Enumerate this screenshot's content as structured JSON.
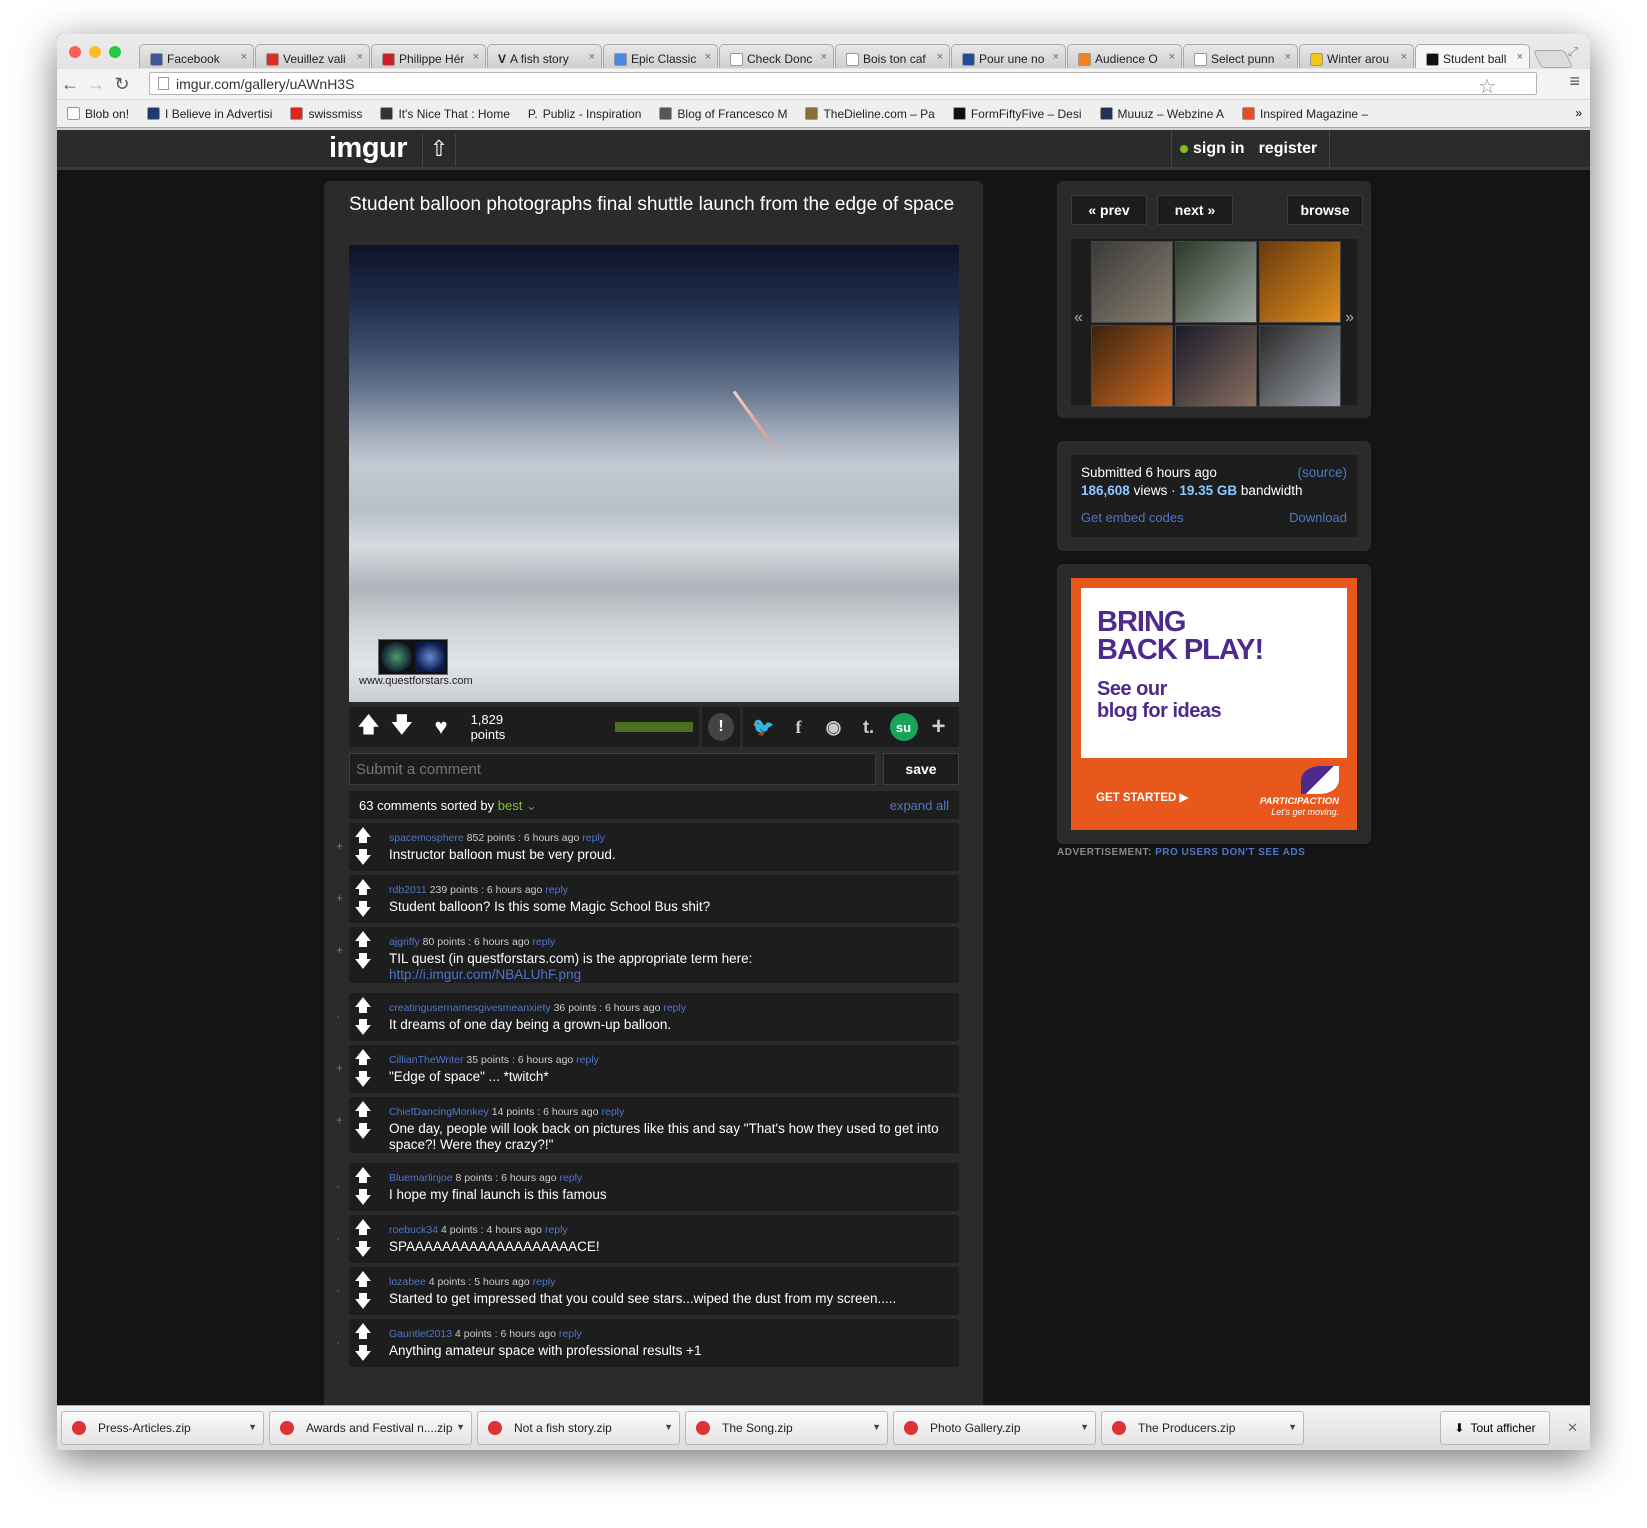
{
  "browser": {
    "tabs": [
      {
        "label": "Facebook",
        "color": "#3b5998"
      },
      {
        "label": "Veuillez vali",
        "color": "#d93025"
      },
      {
        "label": "Philippe Hér",
        "color": "#cb2027"
      },
      {
        "label": "A fish story",
        "color": "#222222",
        "prefix": "V"
      },
      {
        "label": "Epic Classic",
        "color": "#4a86e8"
      },
      {
        "label": "Check Donc",
        "color": "#ffffff"
      },
      {
        "label": "Bois ton caf",
        "color": "#ffffff"
      },
      {
        "label": "Pour une no",
        "color": "#1f4e9a"
      },
      {
        "label": "Audience O",
        "color": "#f58220"
      },
      {
        "label": "Select punn",
        "color": "#ffffff"
      },
      {
        "label": "Winter arou",
        "color": "#f5c518"
      },
      {
        "label": "Student ball",
        "color": "#111111"
      }
    ],
    "url": "imgur.com/gallery/uAWnH3S",
    "bookmarks": [
      {
        "label": "Blob on!",
        "color": "#ffffff"
      },
      {
        "label": "I Believe in Advertisi",
        "color": "#1e3a6e"
      },
      {
        "label": "swissmiss",
        "color": "#e2231a"
      },
      {
        "label": "It's Nice That : Home",
        "color": "#333333"
      },
      {
        "label": "Publiz - Inspiration",
        "color": "#ffffff",
        "prefix": "P."
      },
      {
        "label": "Blog of Francesco M",
        "color": "#555555"
      },
      {
        "label": "TheDieline.com – Pa",
        "color": "#8a6d3b"
      },
      {
        "label": "FormFiftyFive – Desi",
        "color": "#111111"
      },
      {
        "label": "Muuuz – Webzine A",
        "color": "#223355"
      },
      {
        "label": "Inspired Magazine –",
        "color": "#e44d26"
      }
    ]
  },
  "header": {
    "logo": "imgur",
    "sign_in": "sign in",
    "register": "register"
  },
  "post": {
    "title": "Student balloon photographs final shuttle launch from the edge of space",
    "watermark": "www.questforstars.com",
    "points": "1,829 points",
    "points_ratio": 1.0,
    "comment_placeholder": "Submit a comment",
    "save_label": "save",
    "sort_prefix": "63 comments sorted by",
    "sort_value": "best",
    "expand_all": "expand all"
  },
  "comments": [
    {
      "user": "spacemosphere",
      "meta": "852 points : 6 hours ago",
      "reply": "reply",
      "text": "Instructor balloon must be very proud.",
      "link": "",
      "marker": "+"
    },
    {
      "user": "rdb2011",
      "meta": "239 points : 6 hours ago",
      "reply": "reply",
      "text": "Student balloon? Is this some Magic School Bus shit?",
      "link": "",
      "marker": "+"
    },
    {
      "user": "ajgriffy",
      "meta": "80 points : 6 hours ago",
      "reply": "reply",
      "text": "TIL quest (in questforstars.com) is the appropriate term here:",
      "link": "http://i.imgur.com/NBALUhF.png",
      "marker": "+"
    },
    {
      "user": "creatingusernamesgivesmeanxiety",
      "meta": "36 points : 6 hours ago",
      "reply": "reply",
      "text": "It dreams of one day being a grown-up balloon.",
      "link": "",
      "marker": "·"
    },
    {
      "user": "CillianTheWriter",
      "meta": "35 points : 6 hours ago",
      "reply": "reply",
      "text": "\"Edge of space\" ... *twitch*",
      "link": "",
      "marker": "+"
    },
    {
      "user": "ChiefDancingMonkey",
      "meta": "14 points : 6 hours ago",
      "reply": "reply",
      "text": "One day, people will look back on pictures like this and say \"That's how they used to get into space?! Were they crazy?!\"",
      "link": "",
      "marker": "+"
    },
    {
      "user": "Bluemarlinjoe",
      "meta": "8 points : 6 hours ago",
      "reply": "reply",
      "text": "I hope my final launch is this famous",
      "link": "",
      "marker": "·"
    },
    {
      "user": "roebuck34",
      "meta": "4 points : 4 hours ago",
      "reply": "reply",
      "text": "SPAAAAAAAAAAAAAAAAAAACE!",
      "link": "",
      "marker": "·"
    },
    {
      "user": "lozabee",
      "meta": "4 points : 5 hours ago",
      "reply": "reply",
      "text": "Started to get impressed that you could see stars...wiped the dust from my screen.....",
      "link": "",
      "marker": "·"
    },
    {
      "user": "Gauntlet2013",
      "meta": "4 points : 6 hours ago",
      "reply": "reply",
      "text": "Anything amateur space with professional results +1",
      "link": "",
      "marker": "·"
    }
  ],
  "sidebar": {
    "prev": "« prev",
    "next": "next »",
    "browse": "browse",
    "thumbs": [
      {
        "name": "thumb-man-horse",
        "c1": "#3a3a3a",
        "c2": "#8a8070"
      },
      {
        "name": "thumb-smoke-field",
        "c1": "#2a3a2a",
        "c2": "#a0a8a0"
      },
      {
        "name": "thumb-skeleton-decoration",
        "c1": "#6a3a10",
        "c2": "#e0901a"
      },
      {
        "name": "thumb-can",
        "c1": "#3a2410",
        "c2": "#d06a20"
      },
      {
        "name": "thumb-dogs-photo",
        "c1": "#1a1a2a",
        "c2": "#8a7060"
      },
      {
        "name": "thumb-balloons-store",
        "c1": "#2a2a2a",
        "c2": "#9aa0a8"
      }
    ],
    "submitted": "Submitted 6 hours ago",
    "source": "(source)",
    "views": "186,608",
    "views_label": "views ·",
    "bandwidth": "19.35 GB",
    "bandwidth_label": "bandwidth",
    "embed": "Get embed codes",
    "download": "Download",
    "ad": {
      "headline_1": "BRING",
      "headline_2": "BACK PLAY!",
      "sub_1": "See our",
      "sub_2": "blog for ideas",
      "cta": "GET STARTED ▶",
      "brand": "PARTICIPACTION",
      "tagline": "Let's get moving."
    },
    "ad_note": "ADVERTISEMENT:",
    "ad_note_link": "PRO USERS DON'T SEE ADS"
  },
  "downloads": {
    "items": [
      "Press-Articles.zip",
      "Awards and Festival n....zip",
      "Not a fish story.zip",
      "The Song.zip",
      "Photo Gallery.zip",
      "The Producers.zip"
    ],
    "show_all": "Tout afficher"
  }
}
